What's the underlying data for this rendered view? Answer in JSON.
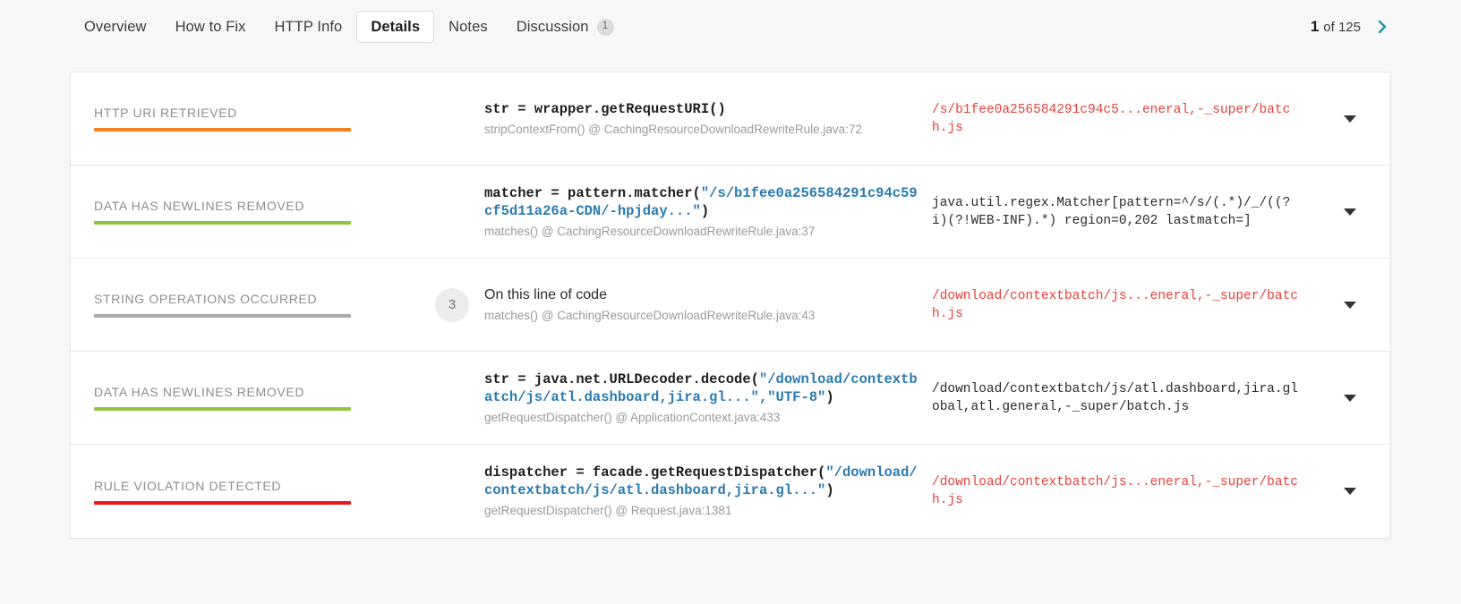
{
  "tabs": [
    {
      "label": "Overview",
      "active": false,
      "badge": null
    },
    {
      "label": "How to Fix",
      "active": false,
      "badge": null
    },
    {
      "label": "HTTP Info",
      "active": false,
      "badge": null
    },
    {
      "label": "Details",
      "active": true,
      "badge": null
    },
    {
      "label": "Notes",
      "active": false,
      "badge": null
    },
    {
      "label": "Discussion",
      "active": false,
      "badge": "1"
    }
  ],
  "pager": {
    "current": "1",
    "rest": "of 125",
    "next_icon": "chevron-right-icon",
    "accent_color": "#1a9aa8"
  },
  "colors": {
    "orange": "#f5811f",
    "green": "#8dc63f",
    "gray": "#a9a9a9",
    "red": "#e8191c",
    "danger_text": "#e8413a",
    "string_literal": "#2a7ab0"
  },
  "rows": [
    {
      "label": "HTTP URI RETRIEVED",
      "bar_color": "#f5811f",
      "count": null,
      "code_prefix": "str = wrapper.getRequestURI()",
      "code_string": "",
      "code_suffix": "",
      "code_plain": false,
      "meta": "stripContextFrom() @ CachingResourceDownloadRewriteRule.java:72",
      "value": "/s/b1fee0a256584291c94c5...eneral,-_super/batch.js",
      "value_danger": true,
      "caret_icon": "chevron-down-icon"
    },
    {
      "label": "DATA HAS NEWLINES REMOVED",
      "bar_color": "#8dc63f",
      "count": null,
      "code_prefix": "matcher = pattern.matcher(",
      "code_string": "\"/s/b1fee0a256584291c94c59cf5d11a26a-CDN/-hpjday...\"",
      "code_suffix": ")",
      "code_plain": false,
      "meta": "matches() @ CachingResourceDownloadRewriteRule.java:37",
      "value": "java.util.regex.Matcher[pattern=^/s/(.*)/_/((?i)(?!WEB-INF).*) region=0,202 lastmatch=]",
      "value_danger": false,
      "caret_icon": "chevron-down-icon"
    },
    {
      "label": "STRING OPERATIONS OCCURRED",
      "bar_color": "#a9a9a9",
      "count": "3",
      "code_prefix": "On this line of code",
      "code_string": "",
      "code_suffix": "",
      "code_plain": true,
      "meta": "matches() @ CachingResourceDownloadRewriteRule.java:43",
      "value": "/download/contextbatch/js...eneral,-_super/batch.js",
      "value_danger": true,
      "caret_icon": "chevron-down-icon"
    },
    {
      "label": "DATA HAS NEWLINES REMOVED",
      "bar_color": "#8dc63f",
      "count": null,
      "code_prefix": "str = java.net.URLDecoder.decode(",
      "code_string": "\"/download/contextbatch/js/atl.dashboard,jira.gl...\",\"UTF-8\"",
      "code_suffix": ")",
      "code_plain": false,
      "meta": "getRequestDispatcher() @ ApplicationContext.java:433",
      "value": "/download/contextbatch/js/atl.dashboard,jira.global,atl.general,-_super/batch.js",
      "value_danger": false,
      "caret_icon": "chevron-down-icon"
    },
    {
      "label": "RULE VIOLATION DETECTED",
      "bar_color": "#e8191c",
      "count": null,
      "code_prefix": "dispatcher = facade.getRequestDispatcher(",
      "code_string": "\"/download/contextbatch/js/atl.dashboard,jira.gl...\"",
      "code_suffix": ")",
      "code_plain": false,
      "meta": "getRequestDispatcher() @ Request.java:1381",
      "value": "/download/contextbatch/js...eneral,-_super/batch.js",
      "value_danger": true,
      "caret_icon": "chevron-down-icon"
    }
  ]
}
